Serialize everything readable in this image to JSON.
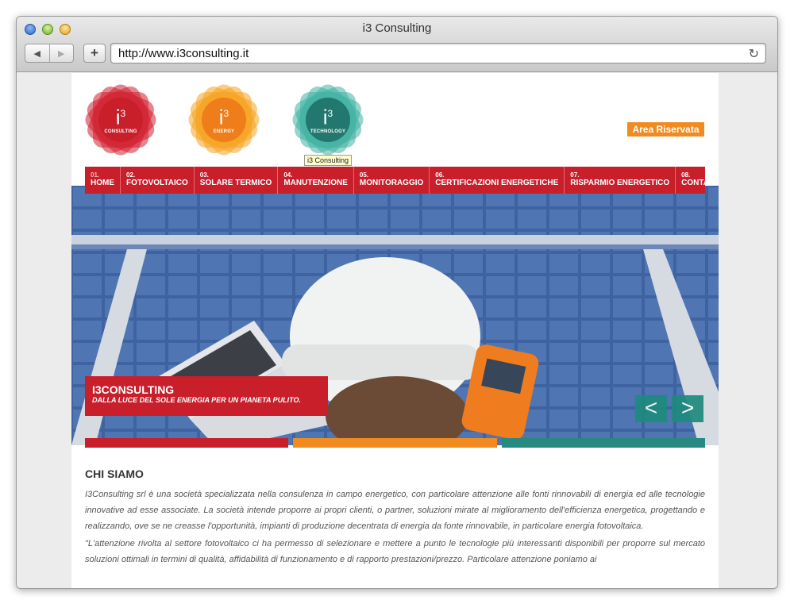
{
  "window": {
    "title": "i3 Consulting"
  },
  "browser": {
    "url": "http://www.i3consulting.it",
    "back": "◀",
    "forward": "▶",
    "plus": "+",
    "reload": "↻"
  },
  "logos": [
    {
      "sup": "3",
      "label": "CONSULTING",
      "color": "#d21f2f"
    },
    {
      "sup": "3",
      "label": "ENERGY",
      "color": "#f08a1d"
    },
    {
      "sup": "3",
      "label": "TECHNOLOGY",
      "color": "#268a80"
    }
  ],
  "tooltip": "i3 Consulting",
  "area_riservata": "Area Riservata",
  "menu": [
    {
      "num": "01.",
      "label": "HOME"
    },
    {
      "num": "02.",
      "label": "FOTOVOLTAICO"
    },
    {
      "num": "03.",
      "label": "SOLARE TERMICO"
    },
    {
      "num": "04.",
      "label": "MANUTENZIONE"
    },
    {
      "num": "05.",
      "label": "MONITORAGGIO"
    },
    {
      "num": "06.",
      "label": "CERTIFICAZIONI ENERGETICHE"
    },
    {
      "num": "07.",
      "label": "RISPARMIO ENERGETICO"
    },
    {
      "num": "08.",
      "label": "CONTATTI"
    }
  ],
  "slider": {
    "title": "I3CONSULTING",
    "subtitle": "DALLA LUCE DEL SOLE ENERGIA PER UN PIANETA PULITO.",
    "prev": "<",
    "next": ">"
  },
  "colors": {
    "red": "#c81f2b",
    "orange": "#f18a1f",
    "teal": "#268a80"
  },
  "content": {
    "heading": "CHI SIAMO",
    "p1": "I3Consulting srl è una società specializzata nella consulenza in campo energetico, con particolare attenzione alle fonti rinnovabili di energia ed alle tecnologie innovative ad esse associate. La società intende proporre ai propri clienti, o partner, soluzioni mirate al miglioramento dell'efficienza energetica, progettando e realizzando, ove se ne creasse l'opportunità, impianti di produzione decentrata di energia da fonte rinnovabile, in particolare energia fotovoltaica.",
    "p2": "\"L'attenzione rivolta al settore fotovoltaico ci ha permesso di selezionare e mettere a punto le tecnologie più interessanti disponibili per proporre sul mercato soluzioni ottimali in termini di qualità, affidabilità di funzionamento e di rapporto prestazioni/prezzo. Particolare attenzione poniamo ai"
  }
}
